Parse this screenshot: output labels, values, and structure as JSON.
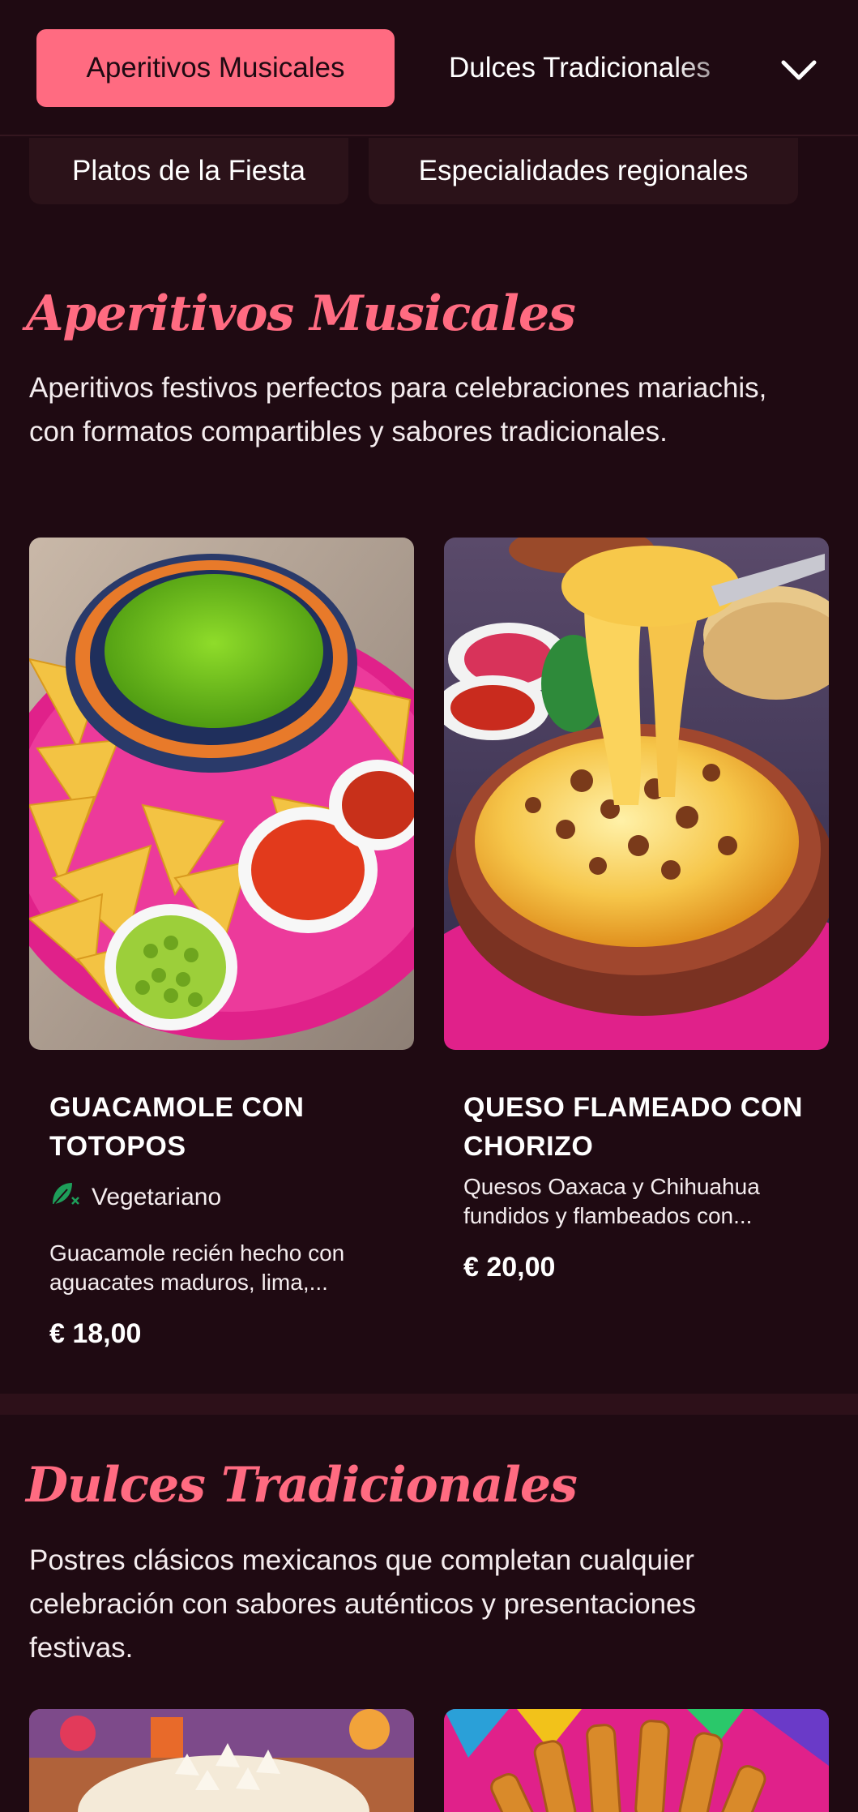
{
  "tabs": {
    "active_label": "Aperitivos Musicales",
    "next_label": "Dulces Tradicionales",
    "row2": [
      "Platos de la Fiesta",
      "Especialidades regionales"
    ],
    "more_icon": "chevron-down-icon"
  },
  "sections": [
    {
      "title": "Aperitivos Musicales",
      "description": "Aperitivos festivos perfectos para celebraciones mariachis, con formatos compartibles y sabores tradicionales.",
      "items": [
        {
          "name": "GUACAMOLE CON TOTOPOS",
          "tag": "Vegetariano",
          "tag_icon": "vegetarian-leaf-icon",
          "description": "Guacamole recién hecho con aguacates maduros, lima,...",
          "price": "€ 18,00"
        },
        {
          "name": "QUESO FLAMEADO CON CHORIZO",
          "description": "Quesos Oaxaca y Chihuahua fundidos y flambeados con...",
          "price": "€ 20,00"
        }
      ]
    },
    {
      "title": "Dulces Tradicionales",
      "description": "Postres clásicos mexicanos que completan cualquier celebración con sabores auténticos y presentaciones festivas."
    }
  ],
  "colors": {
    "background": "#1f0a12",
    "accent": "#ff6b81",
    "tab_bg": "#2b1219",
    "vegetarian": "#1e9e5a"
  }
}
